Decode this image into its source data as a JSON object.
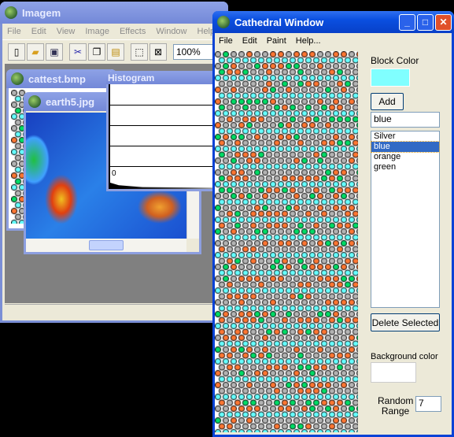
{
  "imagem": {
    "title": "Imagem",
    "menu": [
      "File",
      "Edit",
      "View",
      "Image",
      "Effects",
      "Window",
      "Help"
    ],
    "zoom": "100%",
    "toolbar_icons": [
      "new-icon",
      "open-icon",
      "save-icon",
      "cut-icon",
      "copy-icon",
      "paste-icon",
      "select-icon",
      "deselect-icon"
    ]
  },
  "children": {
    "cattest": "cattest.bmp",
    "earth": "earth5.jpg",
    "histogram": "Histogram",
    "histogram_label": "0"
  },
  "cathedral": {
    "title": "Cathedral Window",
    "menu": [
      "File",
      "Edit",
      "Paint",
      "Help..."
    ],
    "block_color_label": "Block Color",
    "block_color": "#80ffff",
    "add_label": "Add",
    "color_input": "blue",
    "colors": [
      "Silver",
      "blue",
      "orange",
      "green"
    ],
    "selected_color": "blue",
    "delete_label": "Delete Selected",
    "background_color_label": "Background color",
    "background_color": "#ffffff",
    "random_range_label": "Random Range",
    "random_range": "7"
  },
  "palette": {
    "Silver": "#b4b4b4",
    "blue": "#66ffff",
    "orange": "#ff7733",
    "green": "#00dd66"
  }
}
